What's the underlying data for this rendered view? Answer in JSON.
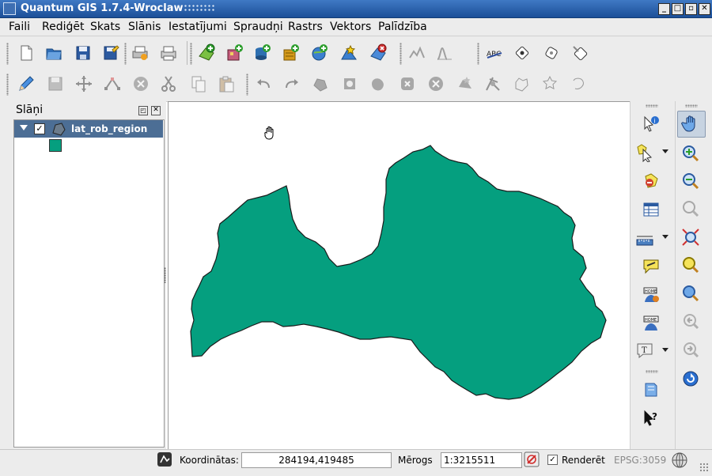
{
  "window": {
    "title": "Quantum GIS 1.7.4-Wroclaw",
    "buttons": [
      "_",
      "□",
      "✕"
    ]
  },
  "menubar": [
    "Faili",
    "Rediģēt",
    "Skats",
    "Slānis",
    "Iestatījumi",
    "Spraudņi",
    "Rastrs",
    "Vektors",
    "Palīdzība"
  ],
  "toolbar_icons": {
    "file": [
      "new-project-icon",
      "open-project-icon",
      "save-project-icon",
      "save-as-icon",
      "print-composer-icon",
      "print-icon"
    ],
    "layers": [
      "add-vector-layer-icon",
      "add-raster-layer-icon",
      "add-postgis-layer-icon",
      "add-spatialite-layer-icon",
      "add-wms-layer-icon",
      "new-shapefile-icon",
      "remove-layer-icon"
    ],
    "analysis": [
      "profile-icon",
      "histogram-icon"
    ],
    "labels": [
      "label-icon",
      "pin-label-icon",
      "rotate-label-icon",
      "move-label-icon"
    ],
    "digitize": [
      "toggle-editing-icon",
      "save-edits-icon",
      "move-feature-icon",
      "node-tool-icon",
      "delete-selected-icon",
      "cut-features-icon",
      "copy-features-icon",
      "paste-features-icon"
    ],
    "advanced": [
      "undo-icon",
      "redo-icon",
      "simplify-feature-icon",
      "add-ring-icon",
      "add-part-icon",
      "delete-ring-icon",
      "delete-part-icon",
      "reshape-features-icon",
      "split-features-icon",
      "merge-features-icon",
      "merge-attributes-icon",
      "rotate-point-symbols-icon"
    ]
  },
  "layers_panel": {
    "title": "Slāņi",
    "layers": [
      {
        "name": "lat_rob_region",
        "checked": true,
        "color": "#059f7f"
      }
    ]
  },
  "map": {
    "fill_color": "#059f7f",
    "outline_color": "#1a1a1a"
  },
  "right_toolbar": [
    "identify-icon",
    "select-icon",
    "deselect-icon",
    "attribute-table-icon",
    "measure-icon",
    "map-tips-icon",
    "new-bookmark-icon",
    "show-bookmarks-icon",
    "text-annotation-icon",
    "help-book-icon",
    "whats-this-icon"
  ],
  "nav_toolbar": [
    "pan-icon",
    "zoom-in-icon",
    "zoom-out-icon",
    "zoom-full-icon",
    "zoom-to-selection-icon",
    "zoom-to-layer-icon",
    "zoom-actual-size-icon",
    "zoom-last-icon",
    "zoom-next-icon",
    "refresh-icon"
  ],
  "status": {
    "coord_label": "Koordinātas:",
    "coordinates": "284194,419485",
    "scale_label": "Mērogs",
    "scale": "1:3215511",
    "render_label": "Renderēt",
    "render_checked": true,
    "crs": "EPSG:3059"
  }
}
